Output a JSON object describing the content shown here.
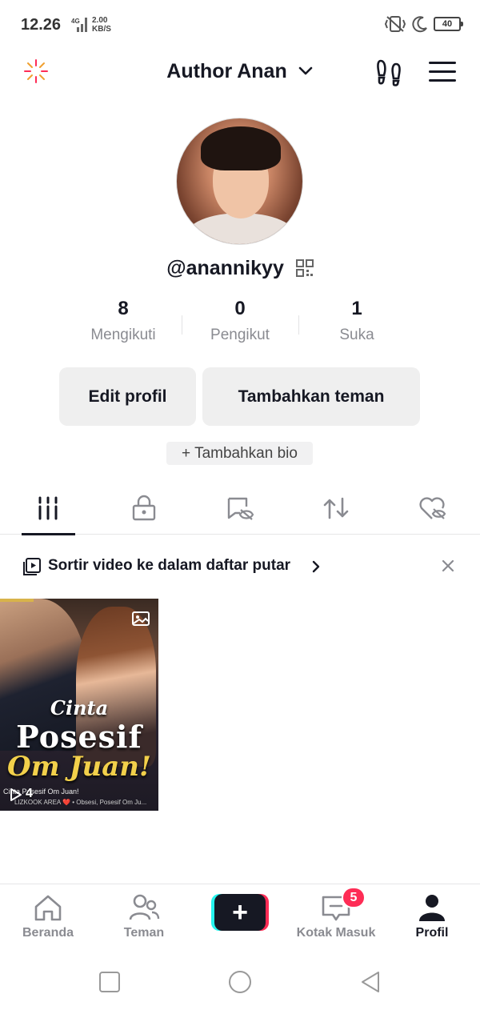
{
  "status_bar": {
    "time": "12.26",
    "network": "4G",
    "speed": "2.00\nKB/S",
    "battery": "40"
  },
  "header": {
    "title": "Author Anan"
  },
  "profile": {
    "handle": "@anannikyy",
    "stats": [
      {
        "value": "8",
        "label": "Mengikuti"
      },
      {
        "value": "0",
        "label": "Pengikut"
      },
      {
        "value": "1",
        "label": "Suka"
      }
    ],
    "edit_button": "Edit profil",
    "add_friends_button": "Tambahkan teman",
    "add_bio": "+ Tambahkan bio"
  },
  "banner": {
    "text": "Sortir video ke dalam daftar putar"
  },
  "video": {
    "title_line1": "Cinta",
    "title_line2": "Posesif",
    "title_line3": "Om Juan!",
    "caption": "Cinta Posesif Om Juan!",
    "caption2": "LIZKOOK AREA ❤️ • Obsesi, Posesif Om Ju...",
    "views": "4"
  },
  "bottom_nav": {
    "items": [
      {
        "label": "Beranda"
      },
      {
        "label": "Teman"
      },
      {
        "label": "Kotak Masuk"
      },
      {
        "label": "Profil"
      }
    ],
    "inbox_badge": "5"
  },
  "colors": {
    "primary_text": "#161823",
    "secondary_text": "#8a8b91",
    "accent_red": "#fe2c55",
    "accent_cyan": "#25f4ee"
  }
}
